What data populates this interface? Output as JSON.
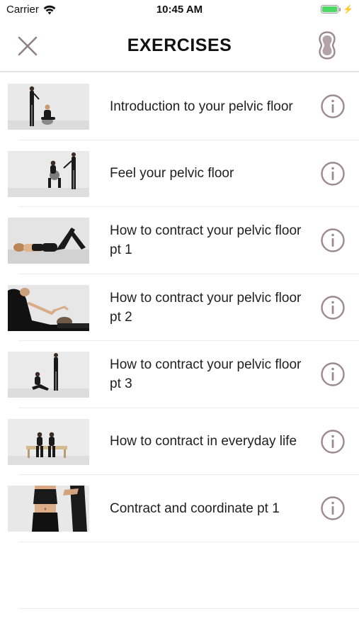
{
  "status_bar": {
    "carrier": "Carrier",
    "time": "10:45 AM",
    "battery_level": 1.0,
    "battery_color": "#4cd964",
    "charging": true
  },
  "header": {
    "title": "EXERCISES",
    "close_icon": "close-icon",
    "device_icon": "pelvic-device-icon",
    "accent": "#a08f95"
  },
  "exercises": [
    {
      "label": "Introduction to your pelvic floor",
      "thumbnail": "two-people-standing-and-seated-photo"
    },
    {
      "label": "Feel your pelvic floor",
      "thumbnail": "person-on-ball-with-trainer-photo"
    },
    {
      "label": "How to contract your pelvic floor pt 1",
      "thumbnail": "person-lying-on-back-photo"
    },
    {
      "label": "How to contract your pelvic floor pt 2",
      "thumbnail": "person-lying-side-view-photo"
    },
    {
      "label": "How to contract your pelvic floor pt 3",
      "thumbnail": "person-seated-floor-with-trainer-photo"
    },
    {
      "label": "How to contract in everyday life",
      "thumbnail": "two-people-on-bench-photo"
    },
    {
      "label": "Contract and coordinate pt 1",
      "thumbnail": "torso-closeup-with-trainer-photo"
    }
  ]
}
